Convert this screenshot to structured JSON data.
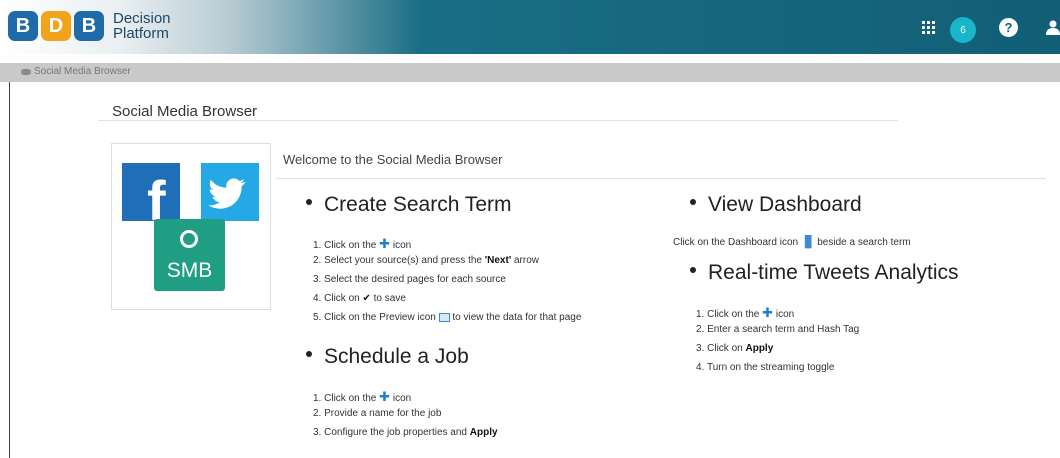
{
  "header": {
    "logo_letters": [
      "B",
      "D",
      "B"
    ],
    "logo_colors": [
      "#1f6aa8",
      "#f3a21b",
      "#1f6aa8"
    ],
    "brand_line1": "Decision",
    "brand_line2": "Platform",
    "apps_icon": "grid-icon",
    "notification_count": "6",
    "help_label": "?",
    "user_icon": "user-icon",
    "accent": "#115f76"
  },
  "breadcrumb": {
    "icon": "cloud-icon",
    "label": "Social Media Browser"
  },
  "page": {
    "title": "Social Media Browser",
    "welcome": "Welcome to the Social Media Browser",
    "panel": {
      "smb_label": "SMB"
    }
  },
  "sections": {
    "create": {
      "title": "Create Search Term",
      "steps": [
        {
          "n": "1.",
          "pre": "Click on the",
          "post": "icon"
        },
        {
          "n": "2.",
          "pre": "Select your source(s) and press the",
          "bold": "'Next'",
          "post": "arrow"
        },
        {
          "n": "3.",
          "pre": "Select the desired pages for each source"
        },
        {
          "n": "4.",
          "pre": "Click on",
          "post": "to save"
        },
        {
          "n": "5.",
          "pre": "Click on the Preview icon",
          "post": "to view the data for that page"
        }
      ]
    },
    "schedule": {
      "title": "Schedule a Job",
      "steps": [
        {
          "n": "1.",
          "pre": "Click on the",
          "post": "icon"
        },
        {
          "n": "2.",
          "pre": "Provide a name for the job"
        },
        {
          "n": "3.",
          "pre": "Configure the job properties and",
          "bold": "Apply"
        }
      ]
    },
    "dashboard": {
      "title": "View Dashboard",
      "pre": "Click on the Dashboard icon",
      "post": "beside a search term"
    },
    "realtime": {
      "title": "Real-time Tweets Analytics",
      "steps": [
        {
          "n": "1.",
          "pre": "Click on the",
          "post": "icon"
        },
        {
          "n": "2.",
          "pre": "Enter a search term and Hash Tag"
        },
        {
          "n": "3.",
          "pre": "Click on",
          "bold": "Apply"
        },
        {
          "n": "4.",
          "pre": "Turn on the streaming toggle"
        }
      ]
    }
  }
}
